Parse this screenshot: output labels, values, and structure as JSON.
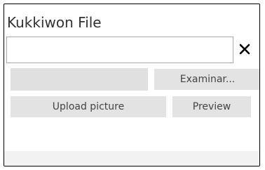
{
  "panel": {
    "title": "Kukkiwon File"
  },
  "file_input": {
    "value": "",
    "clear_icon": "close-icon"
  },
  "file_picker": {
    "path_value": "",
    "browse_label": "Examinar..."
  },
  "actions": {
    "upload_label": "Upload picture",
    "preview_label": "Preview"
  }
}
